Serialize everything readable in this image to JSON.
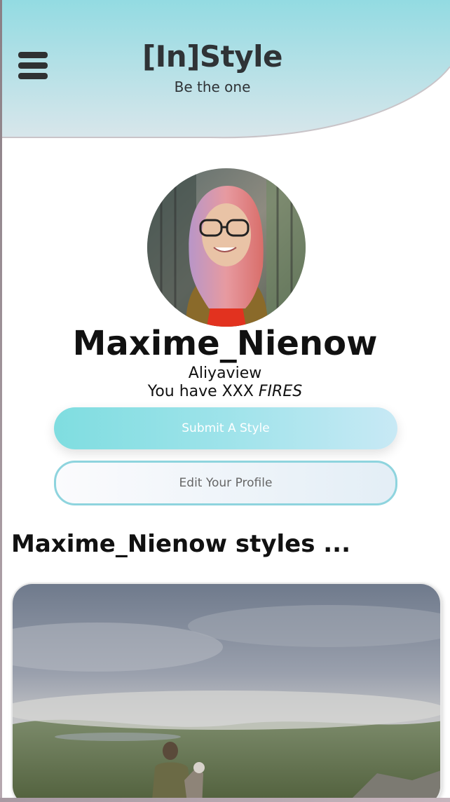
{
  "header": {
    "brand": "[In]Style",
    "tagline": "Be the one",
    "menu_icon": "hamburger-menu-icon",
    "colors": {
      "gradient_start": "#93dbe2",
      "gradient_end": "#d8e6eb"
    }
  },
  "profile": {
    "username": "Maxime_Nienow",
    "handle": "Aliyaview",
    "fires_prefix": "You have XXX ",
    "fires_word": "FIRES",
    "avatar_alt": "profile photo"
  },
  "actions": {
    "submit_label": "Submit A Style",
    "edit_label": "Edit Your Profile"
  },
  "styles_section": {
    "heading": "Maxime_Nienow styles ..."
  },
  "colors": {
    "accent": "#7fdde0",
    "button_border": "#8ed4de"
  }
}
